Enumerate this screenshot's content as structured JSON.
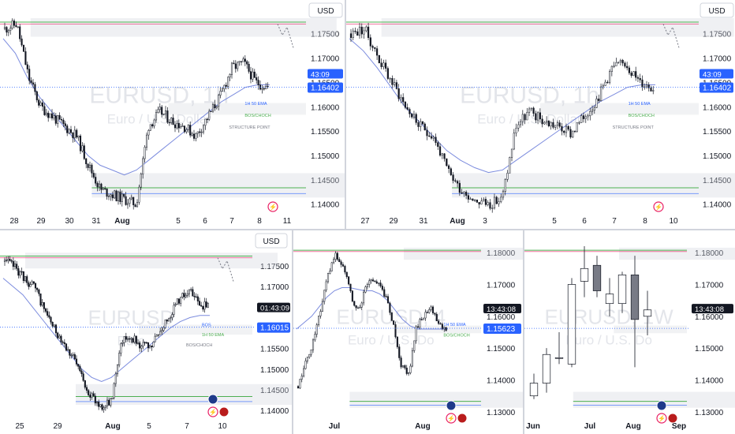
{
  "colors": {
    "bull": "#ffffff",
    "bear": "#131722",
    "ema": "#5b6fd6",
    "zone_green": "#4caf50",
    "zone_pink": "#e91e63",
    "zone_grey": "#d1d4dc",
    "price_blue": "#2962ff",
    "watermark": "#e3e5ea"
  },
  "chart_data": [
    {
      "type": "candlestick",
      "panel": "top-left",
      "currency_button": "USD",
      "watermark": "EURUSD, 1h",
      "watermark_sub": "Euro / U.S. Dollar",
      "x_ticks": [
        "28",
        "29",
        "30",
        "31",
        "Aug",
        "5",
        "6",
        "7",
        "8",
        "11"
      ],
      "y_ticks": [
        "1.17500",
        "1.17000",
        "1.16500",
        "1.16000",
        "1.15500",
        "1.15000",
        "1.14500",
        "1.14000"
      ],
      "ylim": [
        1.1385,
        1.179
      ],
      "countdown": "43:09",
      "last_price": "1.16402",
      "last_price_value": 1.16402,
      "annotations": [
        "1H 50 EMA",
        "BOS/CHOCH",
        "STRUCTURE POINT"
      ],
      "series": [
        {
          "values": [
            1.176,
            1.177,
            1.166,
            1.16,
            1.158,
            1.156,
            1.154,
            1.148,
            1.143,
            1.142,
            1.141,
            1.14,
            1.156,
            1.159,
            1.157,
            1.156,
            1.154,
            1.158,
            1.162,
            1.168,
            1.169,
            1.165,
            1.164
          ]
        }
      ],
      "ema": [
        1.174,
        1.171,
        1.166,
        1.162,
        1.159,
        1.156,
        1.153,
        1.15,
        1.148,
        1.147,
        1.146,
        1.147,
        1.149,
        1.151,
        1.153,
        1.155,
        1.157,
        1.159,
        1.161,
        1.1625,
        1.164,
        1.1645,
        1.1645
      ]
    },
    {
      "type": "candlestick",
      "panel": "top-right",
      "currency_button": "USD",
      "watermark": "EURUSD, 1h",
      "watermark_sub": "Euro / U.S. Dollar",
      "x_ticks": [
        "27",
        "29",
        "31",
        "Aug",
        "3",
        "5",
        "6",
        "7",
        "8",
        "10"
      ],
      "y_ticks": [
        "1.17500",
        "1.17000",
        "1.16500",
        "1.16000",
        "1.15500",
        "1.15000",
        "1.14500",
        "1.14000"
      ],
      "ylim": [
        1.1385,
        1.179
      ],
      "countdown": "43:09",
      "last_price": "1.16402",
      "last_price_value": 1.16402,
      "annotations": [
        "1H 50 EMA",
        "BOS/CHOCH",
        "STRUCTURE POINT"
      ],
      "series": [
        {
          "values": [
            1.175,
            1.176,
            1.17,
            1.165,
            1.16,
            1.156,
            1.154,
            1.147,
            1.143,
            1.141,
            1.14,
            1.141,
            1.156,
            1.159,
            1.157,
            1.156,
            1.1545,
            1.158,
            1.162,
            1.168,
            1.169,
            1.165,
            1.164
          ]
        }
      ],
      "ema": [
        1.174,
        1.1715,
        1.168,
        1.164,
        1.16,
        1.157,
        1.154,
        1.151,
        1.149,
        1.1475,
        1.1465,
        1.147,
        1.149,
        1.151,
        1.153,
        1.155,
        1.157,
        1.159,
        1.161,
        1.1625,
        1.164,
        1.1645,
        1.1645
      ]
    },
    {
      "type": "candlestick",
      "panel": "bottom-left",
      "currency_button": "USD",
      "watermark": "EURUSD",
      "watermark_sub": "Euro",
      "x_ticks": [
        "25",
        "29",
        "Aug",
        "5",
        "7",
        "10"
      ],
      "y_ticks": [
        "1.17500",
        "1.17000",
        "1.16500",
        "1.16000",
        "1.15500",
        "1.15000",
        "1.14500",
        "1.14000"
      ],
      "ylim": [
        1.1385,
        1.179
      ],
      "countdown": "01:43:09",
      "last_price": "1.16015",
      "last_price_value": 1.16015,
      "annotations": [
        "BOS",
        "1H 50 EMA",
        "BOS/CHOCH"
      ],
      "series": [
        {
          "values": [
            1.176,
            1.175,
            1.172,
            1.17,
            1.165,
            1.16,
            1.157,
            1.153,
            1.148,
            1.143,
            1.141,
            1.142,
            1.157,
            1.158,
            1.156,
            1.155,
            1.159,
            1.163,
            1.167,
            1.169,
            1.166,
            1.165
          ]
        }
      ],
      "ema": [
        1.172,
        1.17,
        1.168,
        1.165,
        1.162,
        1.159,
        1.156,
        1.153,
        1.15,
        1.148,
        1.147,
        1.148,
        1.15,
        1.152,
        1.154,
        1.156,
        1.158,
        1.16,
        1.1615,
        1.1625,
        1.163,
        1.163
      ]
    },
    {
      "type": "candlestick",
      "panel": "bottom-middle",
      "watermark": "EURUSD, 4",
      "watermark_sub": "Euro / U.S. Do",
      "x_ticks": [
        "Jul",
        "Aug"
      ],
      "y_ticks": [
        "1.18000",
        "1.17000",
        "1.16000",
        "1.15000",
        "1.14000",
        "1.13000"
      ],
      "ylim": [
        1.1265,
        1.183
      ],
      "countdown": "13:43:08",
      "last_price": "1.15623",
      "last_price_value": 1.15623,
      "annotations": [
        "1H 50 EMA",
        "BOS/CHOCH"
      ],
      "series": [
        {
          "values": [
            1.138,
            1.145,
            1.152,
            1.162,
            1.172,
            1.179,
            1.176,
            1.168,
            1.161,
            1.168,
            1.172,
            1.17,
            1.165,
            1.156,
            1.144,
            1.142,
            1.157,
            1.16,
            1.162,
            1.158,
            1.1562
          ]
        }
      ],
      "ema": [
        1.156,
        1.158,
        1.16,
        1.163,
        1.166,
        1.168,
        1.169,
        1.169,
        1.1685,
        1.168,
        1.168,
        1.167,
        1.165,
        1.162,
        1.159,
        1.157,
        1.156,
        1.156,
        1.156,
        1.156,
        1.156
      ]
    },
    {
      "type": "candlestick",
      "panel": "bottom-right",
      "watermark": "EURUSD, 1W",
      "watermark_sub": "Euro / U.S. Do",
      "x_ticks": [
        "Jun",
        "Jul",
        "Aug",
        "Sep"
      ],
      "y_ticks": [
        "1.18000",
        "1.17000",
        "1.16000",
        "1.15000",
        "1.14000",
        "1.13000"
      ],
      "ylim": [
        1.1265,
        1.183
      ],
      "countdown": "13:43:08",
      "last_price_value": 1.1562,
      "candles": [
        {
          "o": 1.135,
          "h": 1.142,
          "l": 1.134,
          "c": 1.139
        },
        {
          "o": 1.139,
          "h": 1.15,
          "l": 1.136,
          "c": 1.148
        },
        {
          "o": 1.147,
          "h": 1.155,
          "l": 1.145,
          "c": 1.147
        },
        {
          "o": 1.145,
          "h": 1.172,
          "l": 1.144,
          "c": 1.17
        },
        {
          "o": 1.171,
          "h": 1.182,
          "l": 1.166,
          "c": 1.175
        },
        {
          "o": 1.176,
          "h": 1.179,
          "l": 1.166,
          "c": 1.168
        },
        {
          "o": 1.164,
          "h": 1.172,
          "l": 1.16,
          "c": 1.167
        },
        {
          "o": 1.164,
          "h": 1.174,
          "l": 1.161,
          "c": 1.173
        },
        {
          "o": 1.173,
          "h": 1.179,
          "l": 1.144,
          "c": 1.159
        },
        {
          "o": 1.16,
          "h": 1.168,
          "l": 1.154,
          "c": 1.162
        }
      ]
    }
  ]
}
